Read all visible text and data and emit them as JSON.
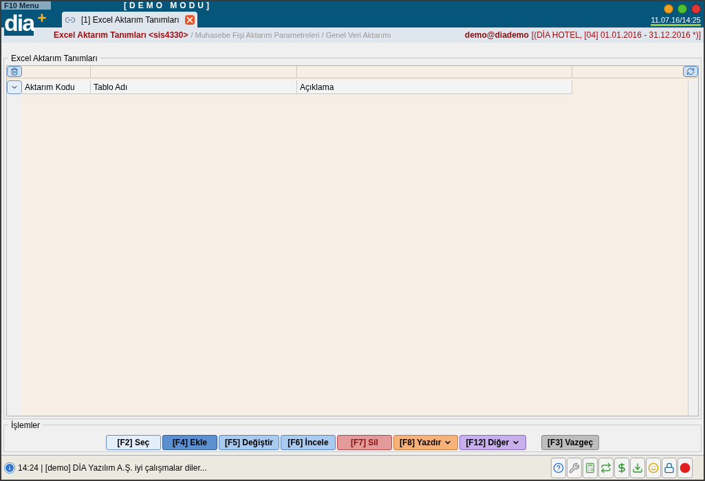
{
  "menu_tab": "F10 Menu",
  "mode_banner": "[DEMO MODU]",
  "logo": "dia",
  "tabs": [
    {
      "label": "[1] Excel Aktarım Tanımları",
      "selected": true
    }
  ],
  "datetime": "11.07.16/14:25",
  "breadcrumb": {
    "current": "Excel Aktarım Tanımları <sis4330>",
    "path": "/ Muhasebe Fişi Aktarım Parametreleri / Genel Veri Aktarımı"
  },
  "user": {
    "login": "demo@diademo",
    "context": "[(DİA HOTEL, [04] 01.01.2016 - 31.12.2016 *)]"
  },
  "grid_panel": {
    "title": "Excel Aktarım Tanımları",
    "columns": [
      "Aktarım Kodu",
      "Tablo Adı",
      "Açıklama"
    ]
  },
  "actions_panel": {
    "title": "İşlemler",
    "buttons": [
      {
        "label": "[F2] Seç",
        "kind": "light",
        "menu": false
      },
      {
        "label": "[F4] Ekle",
        "kind": "primary",
        "menu": false
      },
      {
        "label": "[F5] Değiştir",
        "kind": "info",
        "menu": false
      },
      {
        "label": "[F6] İncele",
        "kind": "info",
        "menu": false
      },
      {
        "label": "[F7] Sil",
        "kind": "danger",
        "menu": false
      },
      {
        "label": "[F8] Yazdır",
        "kind": "print",
        "menu": true
      },
      {
        "label": "[F12] Diğer",
        "kind": "other",
        "menu": true
      },
      {
        "label": "[F3] Vazgeç",
        "kind": "cancel",
        "menu": false
      }
    ]
  },
  "status_bar": {
    "message": "14:24 | [demo] DİA Yazılım A.Ş. iyi çalışmalar diler..."
  }
}
